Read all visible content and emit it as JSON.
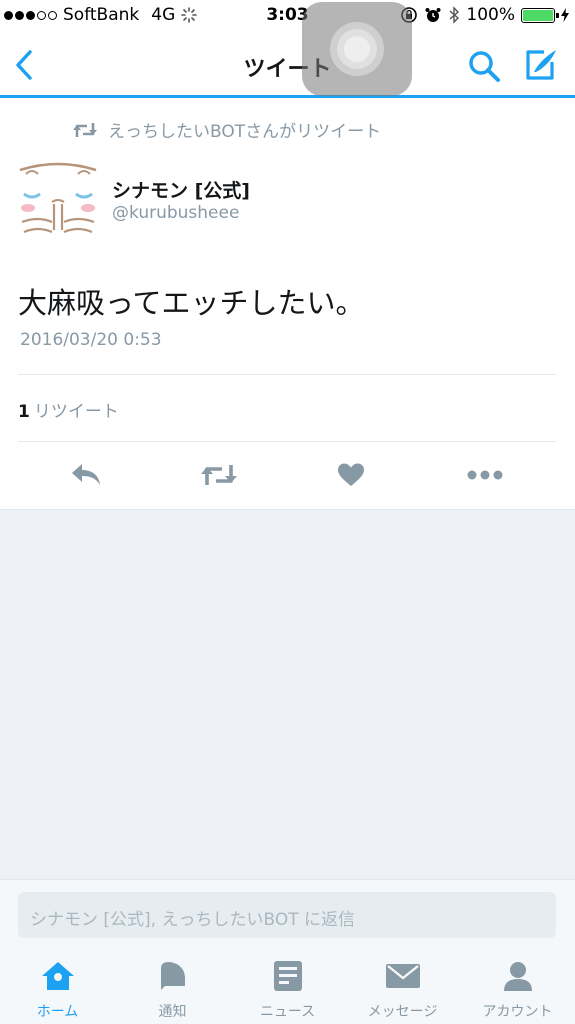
{
  "status_bar": {
    "carrier": "SoftBank",
    "network": "4G",
    "time": "3:03",
    "battery": "100%"
  },
  "nav": {
    "title": "ツイート",
    "icons": [
      "chevron-left-icon",
      "search-icon",
      "compose-icon"
    ],
    "accent_color": "#1da1f2"
  },
  "tweet": {
    "retweet_context": "えっちしたいBOTさんがリツイート",
    "user_name": "シナモン [公式]",
    "user_handle": "@kurubusheee",
    "text": "大麻吸ってエッチしたい。",
    "timestamp": "2016/03/20 0:53",
    "retweet_count": "1",
    "retweet_label": "リツイート",
    "actions": [
      "reply-icon",
      "retweet-icon",
      "like-icon",
      "more-icon"
    ]
  },
  "reply": {
    "placeholder": "シナモン [公式], えっちしたいBOT に返信"
  },
  "tabs": [
    {
      "label": "ホーム",
      "icon": "home-icon",
      "active": true
    },
    {
      "label": "通知",
      "icon": "bell-icon",
      "active": false
    },
    {
      "label": "ニュース",
      "icon": "news-icon",
      "active": false
    },
    {
      "label": "メッセージ",
      "icon": "envelope-icon",
      "active": false
    },
    {
      "label": "アカウント",
      "icon": "person-icon",
      "active": false
    }
  ]
}
